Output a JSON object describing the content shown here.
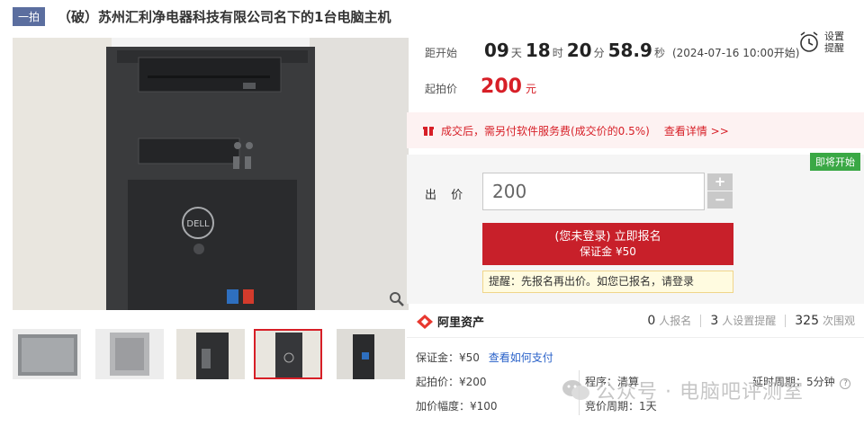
{
  "header": {
    "badge": "一拍",
    "title": "（破）苏州汇利净电器科技有限公司名下的1台电脑主机"
  },
  "countdown": {
    "label": "距开始",
    "days": "09",
    "days_unit": "天",
    "hours": "18",
    "hours_unit": "时",
    "minutes": "20",
    "minutes_unit": "分",
    "seconds": "58.9",
    "seconds_unit": "秒",
    "start_note": "(2024-07-16 10:00开始)"
  },
  "remind": {
    "line1": "设置",
    "line2": "提醒"
  },
  "start_price": {
    "label": "起拍价",
    "value": "200",
    "unit": "元"
  },
  "notice": {
    "text": "成交后，需另付软件服务费(成交价的0.5%)",
    "link": "查看详情 >>"
  },
  "status_tag": "即将开始",
  "bid": {
    "label": "出 价",
    "value": "200",
    "plus": "+",
    "minus": "−",
    "signup_line1": "(您未登录) 立即报名",
    "signup_line2": "保证金 ¥50",
    "hint": "提醒：先报名再出价。如您已报名，请登录"
  },
  "platform": {
    "name": "阿里资产"
  },
  "stats": {
    "signed_count": "0",
    "signed_label": "人报名",
    "remind_count": "3",
    "remind_label": "人设置提醒",
    "view_count": "325",
    "view_label": "次围观"
  },
  "details": {
    "deposit": "保证金：¥50",
    "deposit_link": "查看如何支付",
    "start_price": "起拍价：¥200",
    "increment": "加价幅度：¥100",
    "procedure": "程序：清算",
    "bid_period": "竞价周期：1天",
    "delay": "延时周期：5分钟"
  },
  "watermark": "公众号 · 电脑吧评测室",
  "colors": {
    "accent": "#d71f27",
    "badge": "#5b6e9f",
    "green": "#3aa845",
    "link": "#2a62c9"
  }
}
